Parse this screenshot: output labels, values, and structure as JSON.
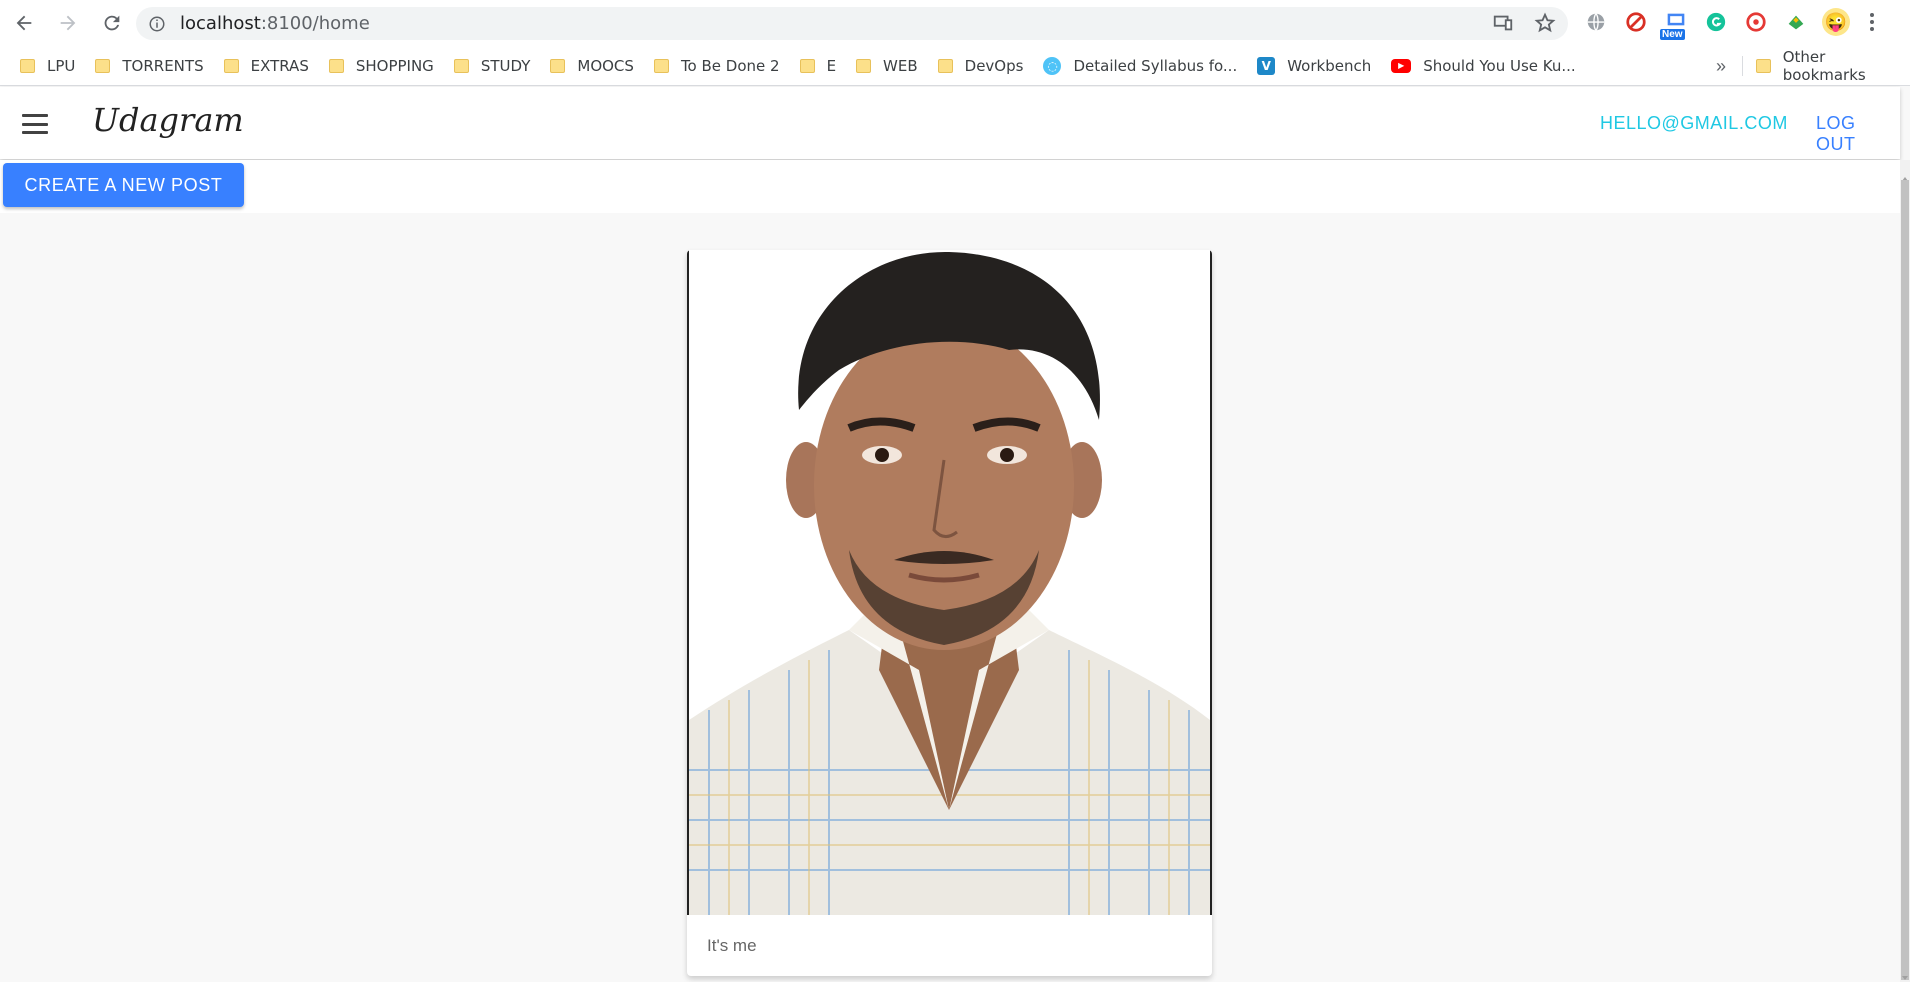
{
  "browser": {
    "url_host": "localhost",
    "url_rest": ":8100/home",
    "ext_new_badge": "New"
  },
  "bookmarks": [
    {
      "label": "LPU",
      "kind": "folder"
    },
    {
      "label": "TORRENTS",
      "kind": "folder"
    },
    {
      "label": "EXTRAS",
      "kind": "folder"
    },
    {
      "label": "SHOPPING",
      "kind": "folder"
    },
    {
      "label": "STUDY",
      "kind": "folder"
    },
    {
      "label": "MOOCS",
      "kind": "folder"
    },
    {
      "label": "To Be Done 2",
      "kind": "folder"
    },
    {
      "label": "E",
      "kind": "folder"
    },
    {
      "label": "WEB",
      "kind": "folder"
    },
    {
      "label": "DevOps",
      "kind": "folder"
    },
    {
      "label": "Detailed Syllabus fo...",
      "kind": "site"
    },
    {
      "label": "Workbench",
      "kind": "site"
    },
    {
      "label": "Should You Use Ku...",
      "kind": "site"
    }
  ],
  "bookmarks_more": "»",
  "other_bookmarks": "Other bookmarks",
  "app": {
    "logo": "Udagram",
    "email": "HELLO@GMAIL.COM",
    "logout": "LOG OUT",
    "create_post": "CREATE A NEW POST"
  },
  "post": {
    "caption": "It's me"
  },
  "colors": {
    "primary": "#3880ff",
    "email_link": "#1fc8e3",
    "page_bg": "#f8f8f8"
  }
}
